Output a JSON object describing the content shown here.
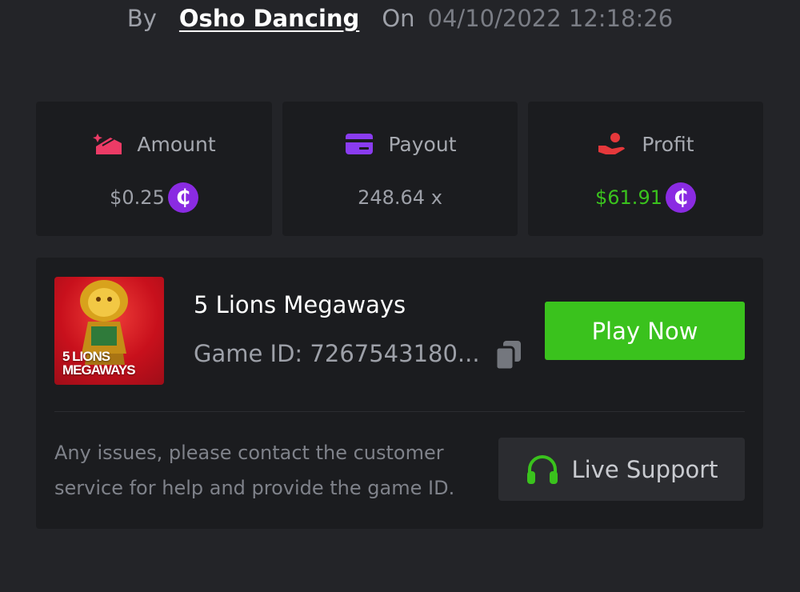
{
  "byline": {
    "by": "By",
    "user": "Osho Dancing",
    "on": "On",
    "datetime": "04/10/2022 12:18:26"
  },
  "stats": {
    "amount": {
      "label": "Amount",
      "value": "$0.25",
      "icon": "wallet-icon"
    },
    "payout": {
      "label": "Payout",
      "value": "248.64 x",
      "icon": "card-icon"
    },
    "profit": {
      "label": "Profit",
      "value": "$61.91",
      "icon": "hand-money-icon"
    }
  },
  "coin_symbol": "₵",
  "game": {
    "name": "5 Lions Megaways",
    "id_label": "Game ID: 7267543180...",
    "thumb_title": "5 LIONS",
    "thumb_subtitle": "MEGAWAYS",
    "play_label": "Play Now"
  },
  "support": {
    "help_text": "Any issues, please contact the customer service for help and provide the game ID.",
    "button_label": "Live Support"
  },
  "colors": {
    "accent_green": "#3ac21d",
    "coin_purple": "#8a2be2",
    "amount_icon": "#ec3b66",
    "payout_icon": "#8a3cf0",
    "profit_icon": "#e5383b"
  }
}
